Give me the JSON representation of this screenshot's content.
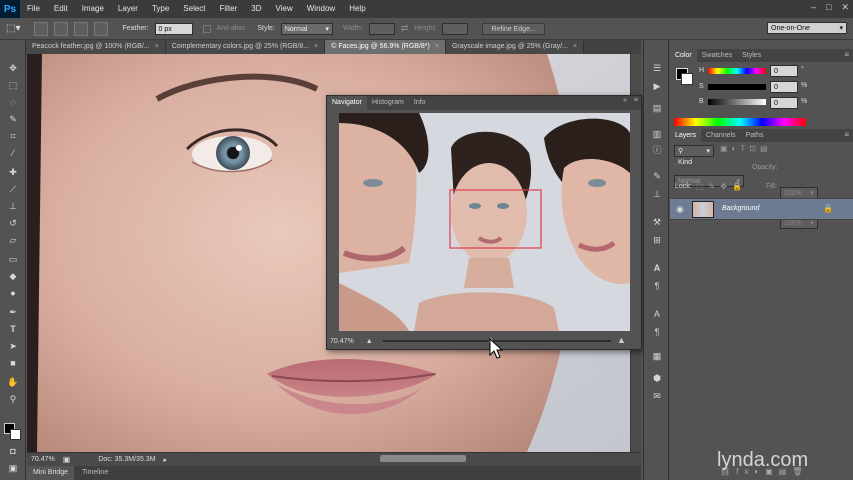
{
  "app": {
    "logo": "Ps"
  },
  "menu": [
    "File",
    "Edit",
    "Image",
    "Layer",
    "Type",
    "Select",
    "Filter",
    "3D",
    "View",
    "Window",
    "Help"
  ],
  "window_buttons": [
    "–",
    "□",
    "✕"
  ],
  "options": {
    "feather_label": "Feather:",
    "feather_value": "0 px",
    "antialias_label": "Anti-alias",
    "style_label": "Style:",
    "style_value": "Normal",
    "width_label": "Width:",
    "height_label": "Height:",
    "refine_edge": "Refine Edge...",
    "workspace": "One-on-One"
  },
  "doc_tabs": [
    {
      "label": "Peacock feather.jpg @ 100% (RGB/...",
      "active": false
    },
    {
      "label": "Complementary colors.jpg @ 25% (RGB/8...",
      "active": false
    },
    {
      "label": "© Faces.jpg @ 56.9% (RGB/8*)",
      "active": true
    },
    {
      "label": "Grayscale image.jpg @ 25% (Gray/...",
      "active": false
    }
  ],
  "status": {
    "zoom": "70.47%",
    "doc": "Doc: 35.3M/35.3M"
  },
  "bottom_tabs": [
    "Mini Bridge",
    "Timeline"
  ],
  "navigator": {
    "tabs": [
      "Navigator",
      "Histogram",
      "Info"
    ],
    "zoom": "70.47%"
  },
  "color_panel": {
    "tabs": [
      "Color",
      "Swatches",
      "Styles"
    ],
    "h_label": "H",
    "s_label": "S",
    "b_label": "B",
    "h_value": "0",
    "s_value": "0",
    "b_value": "0",
    "deg_unit": "°",
    "pct_unit": "%"
  },
  "layers_panel": {
    "tabs": [
      "Layers",
      "Channels",
      "Paths"
    ],
    "filter_label": "Kind",
    "blend_mode": "Normal",
    "opacity_label": "Opacity:",
    "opacity_value": "100%",
    "lock_label": "Lock:",
    "fill_label": "Fill:",
    "fill_value": "100%",
    "layers": [
      {
        "name": "Background",
        "visible": true,
        "locked": true
      }
    ]
  },
  "watermark": "lynda.com",
  "colors": {
    "panel": "#535353",
    "menubar": "#3b3b3b",
    "accent_box": "#e03c4c"
  }
}
